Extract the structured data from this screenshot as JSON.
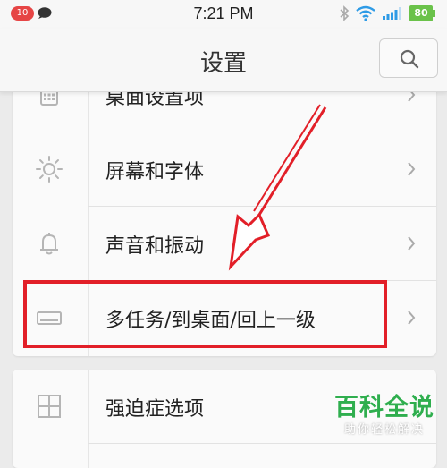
{
  "status_bar": {
    "notification_count": "10",
    "time": "7:21 PM",
    "battery": "80",
    "icons": [
      "chat-bubble-icon",
      "bluetooth-icon",
      "wifi-icon",
      "signal-icon",
      "battery-icon"
    ]
  },
  "header": {
    "title": "设置",
    "search_icon": "search-icon"
  },
  "settings": {
    "group1": [
      {
        "label": "桌面设置项",
        "icon": "grid-dots-icon"
      },
      {
        "label": "屏幕和字体",
        "icon": "sun-icon"
      },
      {
        "label": "声音和振动",
        "icon": "bell-icon"
      },
      {
        "label": "多任务/到桌面/回上一级",
        "icon": "tray-icon"
      }
    ],
    "group2": [
      {
        "label": "强迫症选项",
        "icon": "grid-squares-icon"
      }
    ]
  },
  "annotation": {
    "highlight_color": "#e21f28",
    "arrow_color": "#e21f28"
  },
  "watermark": {
    "title": "百科全说",
    "subtitle": "助你轻松解决"
  },
  "colors": {
    "accent_green": "#2fae4e",
    "battery_green": "#6ac24a",
    "badge_red": "#e64545"
  }
}
